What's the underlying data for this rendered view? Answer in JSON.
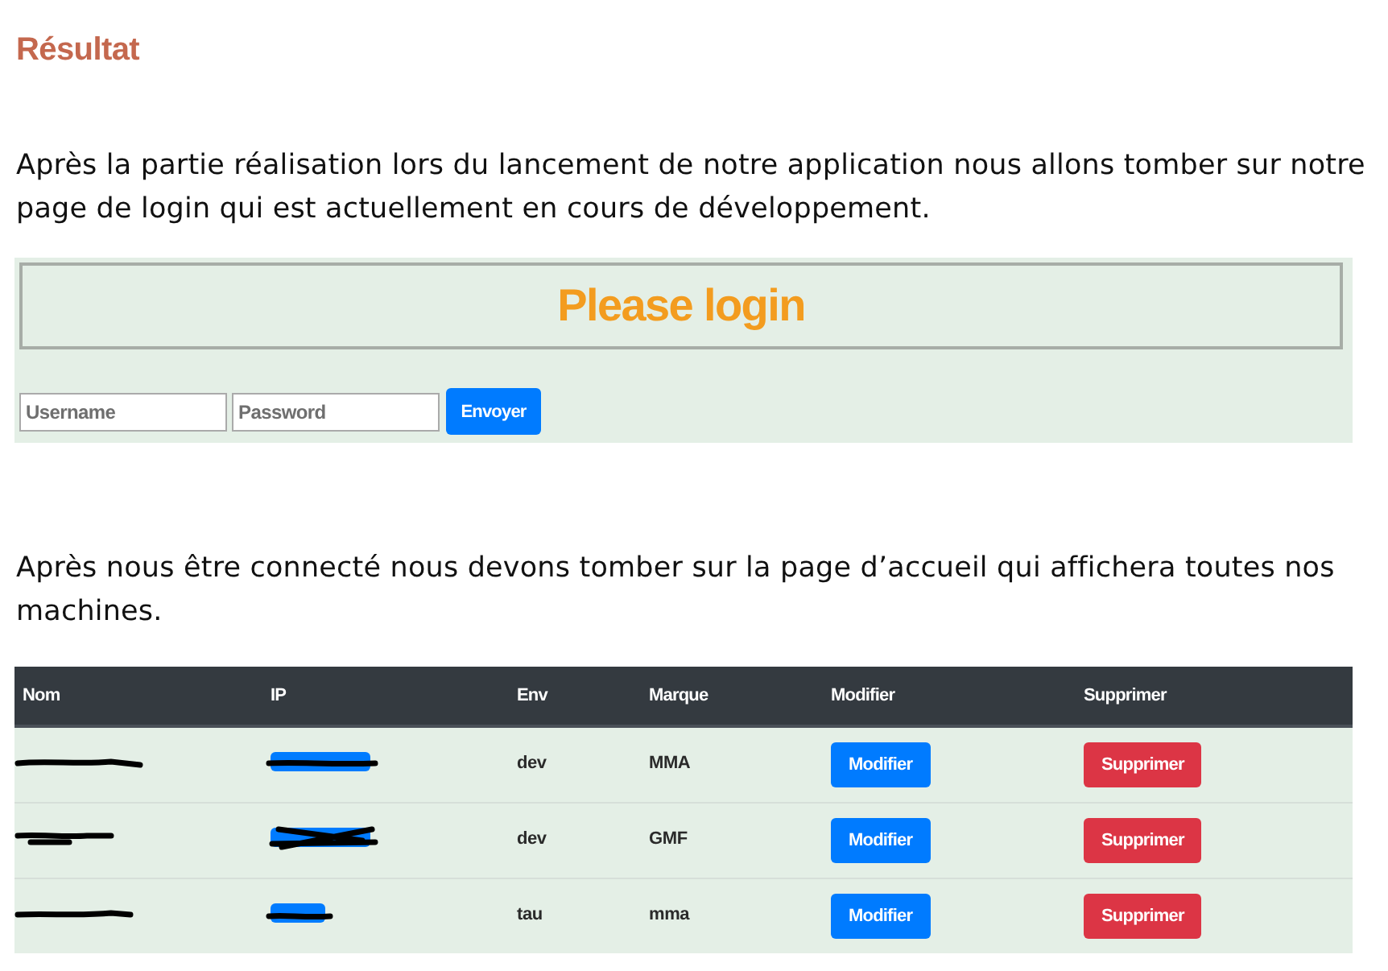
{
  "heading": "Résultat",
  "intro": "Après la partie réalisation lors du lancement de notre application nous allons tomber sur notre page de login qui est actuellement en cours de développement.",
  "login": {
    "title": "Please login",
    "fields": [
      {
        "placeholder": "Username"
      },
      {
        "placeholder": "Password"
      }
    ],
    "submit": "Envoyer"
  },
  "second_paragraph": "Après nous être connecté nous devons tomber sur la page d’accueil qui affichera toutes nos machines.",
  "table": {
    "columns": [
      "Nom",
      "IP",
      "Env",
      "Marque",
      "Modifier",
      "Supprimer"
    ],
    "rows": [
      {
        "cells": [
          {
            "kind": "redacted"
          },
          {
            "kind": "redacted_badge"
          },
          {
            "kind": "text",
            "text": "dev"
          },
          {
            "kind": "text",
            "text": "MMA"
          },
          {
            "kind": "button",
            "text": "Modifier",
            "color": "#007bff"
          },
          {
            "kind": "button",
            "text": "Supprimer",
            "color": "#dc3545"
          }
        ]
      },
      {
        "cells": [
          {
            "kind": "redacted"
          },
          {
            "kind": "redacted_badge"
          },
          {
            "kind": "text",
            "text": "dev"
          },
          {
            "kind": "text",
            "text": "GMF"
          },
          {
            "kind": "button",
            "text": "Modifier",
            "color": "#007bff"
          },
          {
            "kind": "button",
            "text": "Supprimer",
            "color": "#dc3545"
          }
        ]
      },
      {
        "cells": [
          {
            "kind": "redacted"
          },
          {
            "kind": "redacted_badge"
          },
          {
            "kind": "text",
            "text": "tau"
          },
          {
            "kind": "text",
            "text": "mma"
          },
          {
            "kind": "button",
            "text": "Modifier",
            "color": "#007bff"
          },
          {
            "kind": "button",
            "text": "Supprimer",
            "color": "#dc3545"
          }
        ]
      }
    ]
  }
}
